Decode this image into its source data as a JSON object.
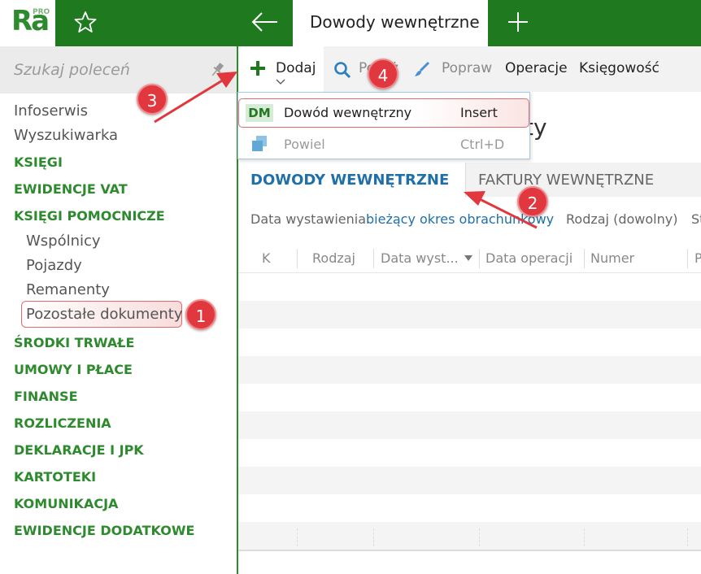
{
  "app": {
    "logo": "Ra",
    "logo_badge": "PRO",
    "active_tab_title": "Dowody wewnętrzne"
  },
  "sidebar": {
    "search_placeholder": "Szukaj poleceń",
    "items": [
      {
        "label": "Infoserwis",
        "kind": "plain"
      },
      {
        "label": "Wyszukiwarka",
        "kind": "plain"
      },
      {
        "label": "KSIĘGI",
        "kind": "section"
      },
      {
        "label": "EWIDENCJE VAT",
        "kind": "section"
      },
      {
        "label": "KSIĘGI POMOCNICZE",
        "kind": "section"
      },
      {
        "label": "Wspólnicy",
        "kind": "sub"
      },
      {
        "label": "Pojazdy",
        "kind": "sub"
      },
      {
        "label": "Remanenty",
        "kind": "sub"
      },
      {
        "label": "Pozostałe dokumenty",
        "kind": "sub"
      },
      {
        "label": "ŚRODKI TRWAŁE",
        "kind": "section"
      },
      {
        "label": "UMOWY I PŁACE",
        "kind": "section"
      },
      {
        "label": "FINANSE",
        "kind": "section"
      },
      {
        "label": "ROZLICZENIA",
        "kind": "section"
      },
      {
        "label": "DEKLARACJE I JPK",
        "kind": "section"
      },
      {
        "label": "KARTOTEKI",
        "kind": "section"
      },
      {
        "label": "KOMUNIKACJA",
        "kind": "section"
      },
      {
        "label": "EWIDENCJE DODATKOWE",
        "kind": "section"
      }
    ]
  },
  "toolbar": {
    "add_label": "Dodaj",
    "show_label": "Pokaż",
    "fix_label": "Popraw",
    "operations_label": "Operacje",
    "accounting_label": "Księgowość"
  },
  "dropdown": {
    "items": [
      {
        "icon": "DM",
        "label": "Dowód wewnętrzny",
        "shortcut": "Insert",
        "enabled": true
      },
      {
        "icon": "copy-icon",
        "label": "Powiel",
        "shortcut": "Ctrl+D",
        "enabled": false
      }
    ]
  },
  "heading_tail": "ty",
  "tabs": {
    "active": "DOWODY WEWNĘTRZNE",
    "inactive": "FAKTURY WEWNĘTRZNE"
  },
  "filters": {
    "date_label": "Data wystawienia",
    "date_value": "bieżący okres obrachunkowy",
    "type_label": "Rodzaj (dowolny)",
    "cut_label": "St"
  },
  "grid": {
    "columns": [
      "K",
      "Rodzaj",
      "Data wyst...",
      "Data operacji",
      "Numer",
      "P"
    ]
  },
  "callouts": [
    "1",
    "2",
    "3",
    "4"
  ],
  "colors": {
    "brand_green": "#1f7a1f",
    "section_green": "#2e8a2e",
    "link_blue": "#1f6fa8",
    "callout_red": "#e0383e"
  }
}
